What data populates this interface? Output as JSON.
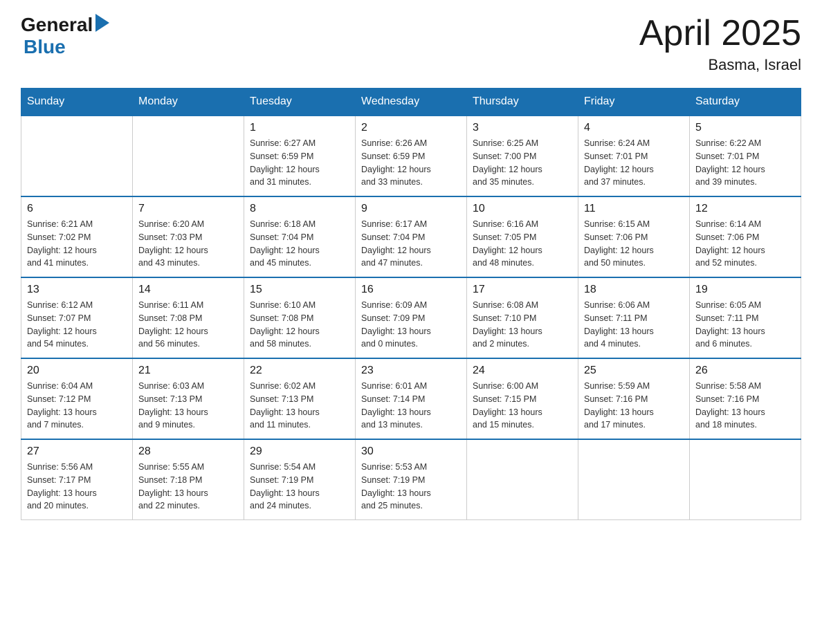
{
  "header": {
    "logo_general": "General",
    "logo_blue": "Blue",
    "title": "April 2025",
    "subtitle": "Basma, Israel"
  },
  "days_of_week": [
    "Sunday",
    "Monday",
    "Tuesday",
    "Wednesday",
    "Thursday",
    "Friday",
    "Saturday"
  ],
  "weeks": [
    {
      "days": [
        {
          "date": "",
          "info": ""
        },
        {
          "date": "",
          "info": ""
        },
        {
          "date": "1",
          "info": "Sunrise: 6:27 AM\nSunset: 6:59 PM\nDaylight: 12 hours\nand 31 minutes."
        },
        {
          "date": "2",
          "info": "Sunrise: 6:26 AM\nSunset: 6:59 PM\nDaylight: 12 hours\nand 33 minutes."
        },
        {
          "date": "3",
          "info": "Sunrise: 6:25 AM\nSunset: 7:00 PM\nDaylight: 12 hours\nand 35 minutes."
        },
        {
          "date": "4",
          "info": "Sunrise: 6:24 AM\nSunset: 7:01 PM\nDaylight: 12 hours\nand 37 minutes."
        },
        {
          "date": "5",
          "info": "Sunrise: 6:22 AM\nSunset: 7:01 PM\nDaylight: 12 hours\nand 39 minutes."
        }
      ]
    },
    {
      "days": [
        {
          "date": "6",
          "info": "Sunrise: 6:21 AM\nSunset: 7:02 PM\nDaylight: 12 hours\nand 41 minutes."
        },
        {
          "date": "7",
          "info": "Sunrise: 6:20 AM\nSunset: 7:03 PM\nDaylight: 12 hours\nand 43 minutes."
        },
        {
          "date": "8",
          "info": "Sunrise: 6:18 AM\nSunset: 7:04 PM\nDaylight: 12 hours\nand 45 minutes."
        },
        {
          "date": "9",
          "info": "Sunrise: 6:17 AM\nSunset: 7:04 PM\nDaylight: 12 hours\nand 47 minutes."
        },
        {
          "date": "10",
          "info": "Sunrise: 6:16 AM\nSunset: 7:05 PM\nDaylight: 12 hours\nand 48 minutes."
        },
        {
          "date": "11",
          "info": "Sunrise: 6:15 AM\nSunset: 7:06 PM\nDaylight: 12 hours\nand 50 minutes."
        },
        {
          "date": "12",
          "info": "Sunrise: 6:14 AM\nSunset: 7:06 PM\nDaylight: 12 hours\nand 52 minutes."
        }
      ]
    },
    {
      "days": [
        {
          "date": "13",
          "info": "Sunrise: 6:12 AM\nSunset: 7:07 PM\nDaylight: 12 hours\nand 54 minutes."
        },
        {
          "date": "14",
          "info": "Sunrise: 6:11 AM\nSunset: 7:08 PM\nDaylight: 12 hours\nand 56 minutes."
        },
        {
          "date": "15",
          "info": "Sunrise: 6:10 AM\nSunset: 7:08 PM\nDaylight: 12 hours\nand 58 minutes."
        },
        {
          "date": "16",
          "info": "Sunrise: 6:09 AM\nSunset: 7:09 PM\nDaylight: 13 hours\nand 0 minutes."
        },
        {
          "date": "17",
          "info": "Sunrise: 6:08 AM\nSunset: 7:10 PM\nDaylight: 13 hours\nand 2 minutes."
        },
        {
          "date": "18",
          "info": "Sunrise: 6:06 AM\nSunset: 7:11 PM\nDaylight: 13 hours\nand 4 minutes."
        },
        {
          "date": "19",
          "info": "Sunrise: 6:05 AM\nSunset: 7:11 PM\nDaylight: 13 hours\nand 6 minutes."
        }
      ]
    },
    {
      "days": [
        {
          "date": "20",
          "info": "Sunrise: 6:04 AM\nSunset: 7:12 PM\nDaylight: 13 hours\nand 7 minutes."
        },
        {
          "date": "21",
          "info": "Sunrise: 6:03 AM\nSunset: 7:13 PM\nDaylight: 13 hours\nand 9 minutes."
        },
        {
          "date": "22",
          "info": "Sunrise: 6:02 AM\nSunset: 7:13 PM\nDaylight: 13 hours\nand 11 minutes."
        },
        {
          "date": "23",
          "info": "Sunrise: 6:01 AM\nSunset: 7:14 PM\nDaylight: 13 hours\nand 13 minutes."
        },
        {
          "date": "24",
          "info": "Sunrise: 6:00 AM\nSunset: 7:15 PM\nDaylight: 13 hours\nand 15 minutes."
        },
        {
          "date": "25",
          "info": "Sunrise: 5:59 AM\nSunset: 7:16 PM\nDaylight: 13 hours\nand 17 minutes."
        },
        {
          "date": "26",
          "info": "Sunrise: 5:58 AM\nSunset: 7:16 PM\nDaylight: 13 hours\nand 18 minutes."
        }
      ]
    },
    {
      "days": [
        {
          "date": "27",
          "info": "Sunrise: 5:56 AM\nSunset: 7:17 PM\nDaylight: 13 hours\nand 20 minutes."
        },
        {
          "date": "28",
          "info": "Sunrise: 5:55 AM\nSunset: 7:18 PM\nDaylight: 13 hours\nand 22 minutes."
        },
        {
          "date": "29",
          "info": "Sunrise: 5:54 AM\nSunset: 7:19 PM\nDaylight: 13 hours\nand 24 minutes."
        },
        {
          "date": "30",
          "info": "Sunrise: 5:53 AM\nSunset: 7:19 PM\nDaylight: 13 hours\nand 25 minutes."
        },
        {
          "date": "",
          "info": ""
        },
        {
          "date": "",
          "info": ""
        },
        {
          "date": "",
          "info": ""
        }
      ]
    }
  ]
}
